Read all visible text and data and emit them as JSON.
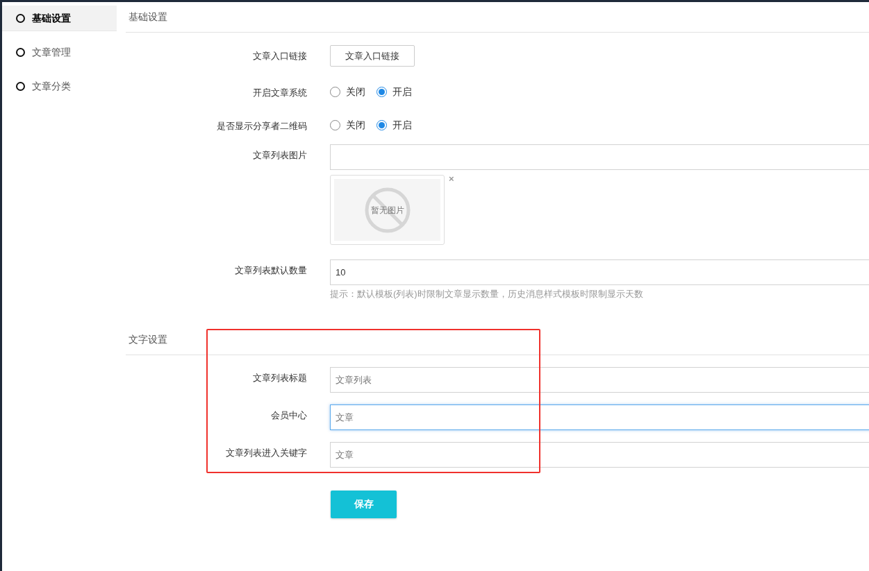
{
  "sidebar": {
    "items": [
      {
        "label": "基础设置",
        "selected": true
      },
      {
        "label": "文章管理",
        "selected": false
      },
      {
        "label": "文章分类",
        "selected": false
      }
    ]
  },
  "basic_section": {
    "title": "基础设置",
    "rows": [
      {
        "kind": "button",
        "label": "文章入口链接",
        "button": "文章入口链接"
      },
      {
        "kind": "radio",
        "label": "开启文章系统",
        "options": [
          {
            "label": "关闭",
            "selected": false
          },
          {
            "label": "开启",
            "selected": true
          }
        ]
      },
      {
        "kind": "radio",
        "label": "是否显示分享者二维码",
        "options": [
          {
            "label": "关闭",
            "selected": false
          },
          {
            "label": "开启",
            "selected": true
          }
        ]
      },
      {
        "kind": "image",
        "label": "文章列表图片",
        "value": "",
        "image_text": "暂无图片",
        "remove": "×"
      },
      {
        "kind": "input",
        "label": "文章列表默认数量",
        "value": "10",
        "hint": "提示：默认模板(列表)时限制文章显示数量，历史消息样式模板时限制显示天数"
      }
    ]
  },
  "text_section": {
    "title": "文字设置",
    "highlighted": true,
    "rows": [
      {
        "label": "文章列表标题",
        "placeholder": "文章列表",
        "focused": false
      },
      {
        "label": "会员中心",
        "placeholder": "文章",
        "focused": true
      },
      {
        "label": "文章列表进入关键字",
        "placeholder": "文章",
        "focused": false
      }
    ]
  },
  "save_button": "保存"
}
